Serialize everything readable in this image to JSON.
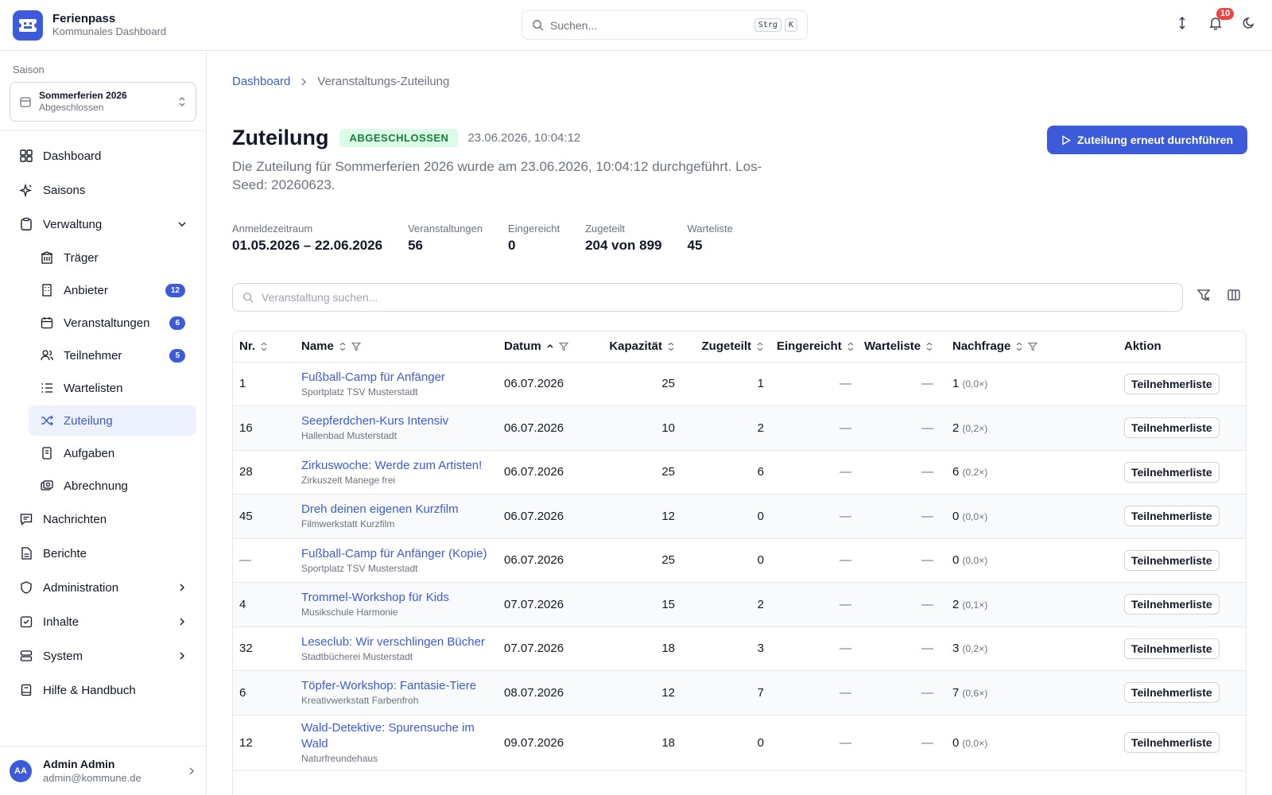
{
  "app": {
    "title": "Ferienpass",
    "subtitle": "Kommunales Dashboard"
  },
  "header": {
    "search_placeholder": "Suchen...",
    "shortcut_keys": [
      "Strg",
      "K"
    ],
    "notification_count": "10",
    "icons": [
      "resize-vertical-icon",
      "bell-icon",
      "moon-icon"
    ]
  },
  "sidebar": {
    "season_label": "Saison",
    "season_name": "Sommerferien 2026",
    "season_status": "Abgeschlossen",
    "items": [
      {
        "label": "Dashboard",
        "icon": "dashboard-icon"
      },
      {
        "label": "Saisons",
        "icon": "sparkle-icon"
      },
      {
        "label": "Verwaltung",
        "icon": "clipboard-icon",
        "expanded": true
      }
    ],
    "sub_items": [
      {
        "label": "Träger",
        "icon": "building-icon",
        "badge": ""
      },
      {
        "label": "Anbieter",
        "icon": "office-icon",
        "badge": "12"
      },
      {
        "label": "Veranstaltungen",
        "icon": "calendar-icon",
        "badge": "6"
      },
      {
        "label": "Teilnehmer",
        "icon": "users-icon",
        "badge": "5"
      },
      {
        "label": "Wartelisten",
        "icon": "list-icon",
        "badge": ""
      },
      {
        "label": "Zuteilung",
        "icon": "shuffle-icon",
        "badge": "",
        "active": true
      },
      {
        "label": "Aufgaben",
        "icon": "task-icon",
        "badge": ""
      },
      {
        "label": "Abrechnung",
        "icon": "billing-icon",
        "badge": ""
      }
    ],
    "bottom_items": [
      {
        "label": "Nachrichten",
        "icon": "message-icon",
        "chevron": false
      },
      {
        "label": "Berichte",
        "icon": "report-icon",
        "chevron": false
      },
      {
        "label": "Administration",
        "icon": "shield-icon",
        "chevron": true
      },
      {
        "label": "Inhalte",
        "icon": "content-icon",
        "chevron": true
      },
      {
        "label": "System",
        "icon": "server-icon",
        "chevron": true
      },
      {
        "label": "Hilfe & Handbuch",
        "icon": "book-icon",
        "chevron": false
      }
    ],
    "user": {
      "initials": "AA",
      "name": "Admin Admin",
      "email": "admin@kommune.de"
    }
  },
  "breadcrumb": {
    "root": "Dashboard",
    "current": "Veranstaltungs-Zuteilung"
  },
  "page": {
    "title": "Zuteilung",
    "status": "ABGESCHLOSSEN",
    "timestamp": "23.06.2026, 10:04:12",
    "description": "Die Zuteilung für Sommerferien 2026 wurde am 23.06.2026, 10:04:12 durchgeführt. Los-Seed: 20260623.",
    "primary_action": "Zuteilung erneut durchführen"
  },
  "stats": [
    {
      "label": "Anmeldezeitraum",
      "value": "01.05.2026 – 22.06.2026"
    },
    {
      "label": "Veranstaltungen",
      "value": "56"
    },
    {
      "label": "Eingereicht",
      "value": "0"
    },
    {
      "label": "Zugeteilt",
      "value": "204 von 899"
    },
    {
      "label": "Warteliste",
      "value": "45"
    }
  ],
  "table": {
    "search_placeholder": "Veranstaltung suchen...",
    "columns": [
      "Nr.",
      "Name",
      "Datum",
      "Kapazität",
      "Zugeteilt",
      "Eingereicht",
      "Warteliste",
      "Nachfrage",
      "Aktion"
    ],
    "action_label": "Teilnehmerliste",
    "rows": [
      {
        "nr": "1",
        "name": "Fußball-Camp für Anfänger",
        "place": "Sportplatz TSV Musterstadt",
        "date": "06.07.2026",
        "capacity": "25",
        "assigned": "1",
        "submitted": "—",
        "waitlist": "—",
        "demand": "1",
        "ratio": "(0,0×)"
      },
      {
        "nr": "16",
        "name": "Seepferdchen-Kurs Intensiv",
        "place": "Hallenbad Musterstadt",
        "date": "06.07.2026",
        "capacity": "10",
        "assigned": "2",
        "submitted": "—",
        "waitlist": "—",
        "demand": "2",
        "ratio": "(0,2×)"
      },
      {
        "nr": "28",
        "name": "Zirkuswoche: Werde zum Artisten!",
        "place": "Zirkuszelt Manege frei",
        "date": "06.07.2026",
        "capacity": "25",
        "assigned": "6",
        "submitted": "—",
        "waitlist": "—",
        "demand": "6",
        "ratio": "(0,2×)"
      },
      {
        "nr": "45",
        "name": "Dreh deinen eigenen Kurzfilm",
        "place": "Filmwerkstatt Kurzfilm",
        "date": "06.07.2026",
        "capacity": "12",
        "assigned": "0",
        "submitted": "—",
        "waitlist": "—",
        "demand": "0",
        "ratio": "(0,0×)"
      },
      {
        "nr": "—",
        "name": "Fußball-Camp für Anfänger (Kopie)",
        "place": "Sportplatz TSV Musterstadt",
        "date": "06.07.2026",
        "capacity": "25",
        "assigned": "0",
        "submitted": "—",
        "waitlist": "—",
        "demand": "0",
        "ratio": "(0,0×)"
      },
      {
        "nr": "4",
        "name": "Trommel-Workshop für Kids",
        "place": "Musikschule Harmonie",
        "date": "07.07.2026",
        "capacity": "15",
        "assigned": "2",
        "submitted": "—",
        "waitlist": "—",
        "demand": "2",
        "ratio": "(0,1×)"
      },
      {
        "nr": "32",
        "name": "Leseclub: Wir verschlingen Bücher",
        "place": "Stadtbücherei Musterstadt",
        "date": "07.07.2026",
        "capacity": "18",
        "assigned": "3",
        "submitted": "—",
        "waitlist": "—",
        "demand": "3",
        "ratio": "(0,2×)"
      },
      {
        "nr": "6",
        "name": "Töpfer-Workshop: Fantasie-Tiere",
        "place": "Kreativwerkstatt Farbenfroh",
        "date": "08.07.2026",
        "capacity": "12",
        "assigned": "7",
        "submitted": "—",
        "waitlist": "—",
        "demand": "7",
        "ratio": "(0,6×)"
      },
      {
        "nr": "12",
        "name": "Wald-Detektive: Spurensuche im Wald",
        "place": "Naturfreundehaus",
        "date": "09.07.2026",
        "capacity": "18",
        "assigned": "0",
        "submitted": "—",
        "waitlist": "—",
        "demand": "0",
        "ratio": "(0,0×)"
      }
    ]
  },
  "colors": {
    "accent": "#3b5bdb",
    "success_bg": "#dcfce7",
    "success_text": "#15803d",
    "danger": "#ef4444"
  }
}
